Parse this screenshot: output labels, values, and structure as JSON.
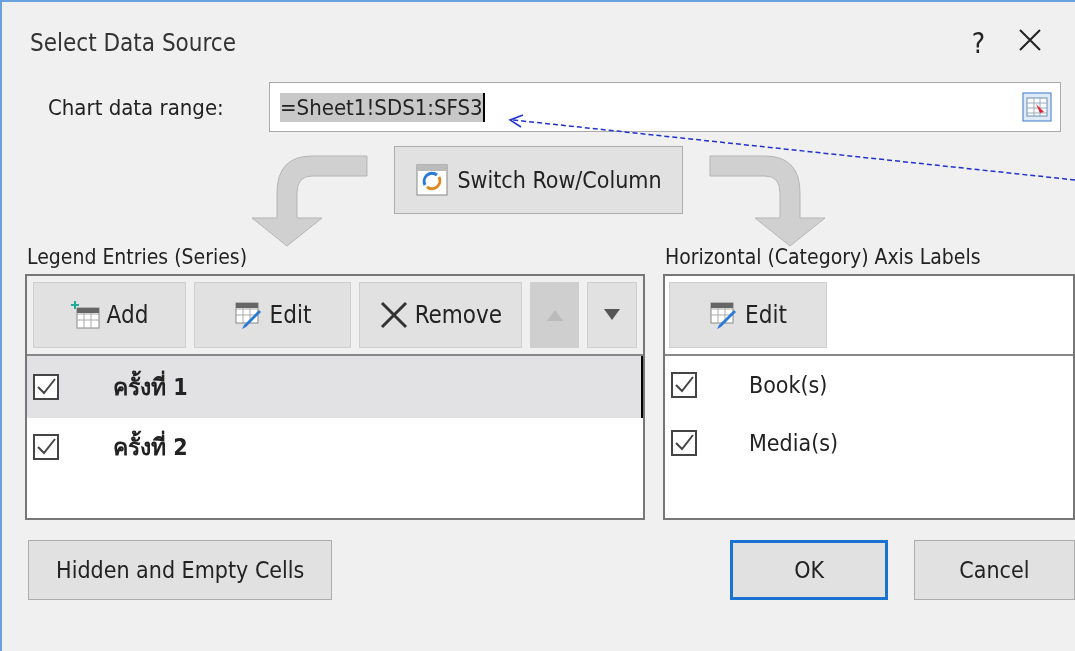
{
  "window": {
    "title": "Select Data Source",
    "help": "?"
  },
  "data_range": {
    "label": "Chart data range:",
    "value": "=Sheet1!SDS1:SFS3"
  },
  "switch_button": "Switch Row/Column",
  "legend": {
    "heading": "Legend Entries (Series)",
    "toolbar": [
      {
        "kind": "add",
        "label": "Add",
        "disabled": false
      },
      {
        "kind": "edit",
        "label": "Edit",
        "disabled": false
      },
      {
        "kind": "remove",
        "label": "Remove",
        "disabled": false
      },
      {
        "kind": "up",
        "disabled": true
      },
      {
        "kind": "down",
        "disabled": false
      }
    ],
    "items": [
      {
        "label": "ครั้งที่ 1",
        "checked": true,
        "selected": true
      },
      {
        "label": "ครั้งที่ 2",
        "checked": true,
        "selected": false
      }
    ]
  },
  "axis": {
    "heading": "Horizontal (Category) Axis Labels",
    "toolbar": [
      {
        "kind": "edit",
        "label": "Edit",
        "disabled": false
      }
    ],
    "items": [
      {
        "label": "Book(s)",
        "checked": true,
        "selected": false
      },
      {
        "label": "Media(s)",
        "checked": true,
        "selected": false
      }
    ]
  },
  "buttons": [
    {
      "kind": "secondary",
      "label": "Hidden and Empty Cells"
    },
    {
      "kind": "default",
      "label": "OK"
    },
    {
      "kind": "secondary",
      "label": "Cancel"
    }
  ]
}
